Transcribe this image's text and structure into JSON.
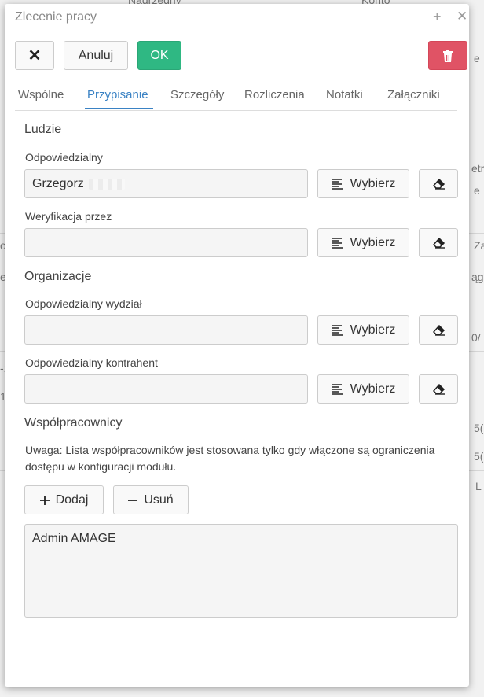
{
  "dialog": {
    "title": "Zlecenie pracy",
    "title_plus": "+",
    "title_close": "✕"
  },
  "toolbar": {
    "close_glyph": "✕",
    "cancel_label": "Anuluj",
    "ok_label": "OK"
  },
  "tabs": [
    {
      "label": "Wspólne"
    },
    {
      "label": "Przypisanie",
      "active": true
    },
    {
      "label": "Szczegóły"
    },
    {
      "label": "Rozliczenia"
    },
    {
      "label": "Notatki"
    },
    {
      "label": "Załączniki"
    }
  ],
  "people": {
    "section_title": "Ludzie",
    "responsible_label": "Odpowiedzialny",
    "responsible_value": "Grzegorz",
    "verification_label": "Weryfikacja przez",
    "verification_value": ""
  },
  "organizations": {
    "section_title": "Organizacje",
    "department_label": "Odpowiedzialny wydział",
    "department_value": "",
    "contractor_label": "Odpowiedzialny kontrahent",
    "contractor_value": ""
  },
  "pick_button_label": "Wybierz",
  "coworkers": {
    "section_title": "Współpracownicy",
    "note": "Uwaga: Lista współpracowników jest stosowana tylko gdy włączone są ograniczenia dostępu w konfiguracji modułu.",
    "add_label": "Dodaj",
    "remove_label": "Usuń",
    "items": [
      "Admin AMAGE"
    ]
  },
  "background": {
    "texts": [
      "Nadrzędny",
      "Konto",
      "e",
      "etr",
      "e",
      "o",
      "Za",
      "e",
      "ąg",
      "0/",
      "-1",
      "1",
      "5(",
      "5(",
      "L"
    ]
  },
  "colors": {
    "accent": "#3a82c4",
    "ok": "#2fb883",
    "danger": "#e05365"
  }
}
